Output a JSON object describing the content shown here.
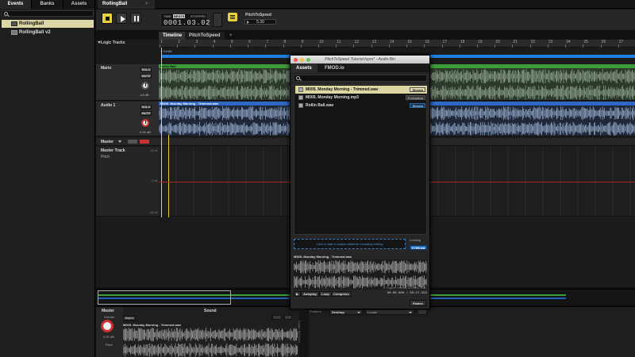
{
  "browser": {
    "tabs": [
      "Events",
      "Banks",
      "Assets"
    ],
    "active_tab": 0,
    "events": [
      {
        "label": "RollingBall",
        "selected": true
      },
      {
        "label": "RollingBall v2",
        "selected": false
      }
    ]
  },
  "document": {
    "tab_label": "RollingBall",
    "add_tab": "+"
  },
  "transport": {
    "clock_mode_time": "TIME",
    "clock_mode_beats": "BEATS",
    "clock_state": "STOPPED",
    "clock_value": "0001.03.02",
    "parameter_name": "PitchToSpeed",
    "parameter_value": "5.30"
  },
  "editor": {
    "tabs": [
      "Timeline",
      "PitchToSpeed",
      "+"
    ],
    "logic_tracks_label": "Logic Tracks",
    "playhead_label": "+ 0:0.66",
    "ruler_ticks": [
      "1",
      "2",
      "3",
      "4",
      "5",
      "6",
      "7",
      "8",
      "9",
      "10",
      "11",
      "12",
      "13",
      "14",
      "15",
      "16",
      "17",
      "18",
      "19",
      "20",
      "21",
      "22",
      "23",
      "24",
      "25",
      "26",
      "27"
    ],
    "tracks": [
      {
        "name": "Mario",
        "region": "Rollin Ball",
        "region_color": "#3d9c3a",
        "solo": "SOLO",
        "mute": "MUTE",
        "volume": "-inf dB"
      },
      {
        "name": "Audio 1",
        "region": "M005. Monday Morning - Trimmed.wav",
        "region_color": "#2f68c4",
        "solo": "SOLO",
        "mute": "MUTE",
        "volume": "0.00 dB"
      }
    ],
    "master": {
      "label": "Master",
      "track_name": "Master Track",
      "pitch_label": "Pitch",
      "scale_top": "24 st",
      "scale_mid": "0 st",
      "scale_bottom": "-24 st"
    }
  },
  "deck": {
    "master_title": "Master",
    "sound_title": "Sound",
    "volume_label": "Volume",
    "volume_value": "0.00 dB",
    "pitch_label": "Pitch",
    "async_label": "Async",
    "waveform_title": "M005. Monday Morning - Trimmed.wav",
    "side_tab": "Trigger Behavior"
  },
  "audio_bin": {
    "title": "PitchToSpeed Tutorial.fspro* - Audio Bin",
    "tabs": [
      "Assets",
      "FMOD.io"
    ],
    "active_tab": 0,
    "assets": [
      {
        "name": "M005. Monday Morning - Trimmed.wav",
        "badge": "Stream",
        "badge_style": "light",
        "selected": true
      },
      {
        "name": "M005. Monday Morning.mp3",
        "badge": "Preloaded",
        "badge_style": "gray",
        "selected": false
      },
      {
        "name": "Rollin Ball.wav",
        "badge": "Stream",
        "badge_style": "blue",
        "selected": false
      }
    ],
    "encoding_hint": "Click to add a custom platform encoding setting",
    "loading_label": "Loading",
    "loading_value": "STREAM",
    "preview_title": "M005. Monday Morning - Trimmed.wav",
    "preview_info": "Original: 34.8 kB, 44.1 kHz, 2 Ch",
    "autoplay": "Autoplay",
    "loop": "Loop",
    "compress": "Compress",
    "time": "00:00.000 / 03:17.523",
    "flatten": "Flatten",
    "platform_label": "Platform",
    "platform_value": "Desktop",
    "locale_label": "Locale"
  },
  "colors": {
    "accent_yellow": "#e6d23c",
    "selection": "#dbd6a4",
    "loop_blue": "#1f7fdd",
    "track_green": "#3d9c3a",
    "track_blue": "#2f68c4",
    "pitch_red": "#a82828"
  },
  "icons": {
    "search": "magnifier-icon",
    "stop": "stop-icon",
    "play": "play-icon",
    "pause": "pause-icon"
  }
}
